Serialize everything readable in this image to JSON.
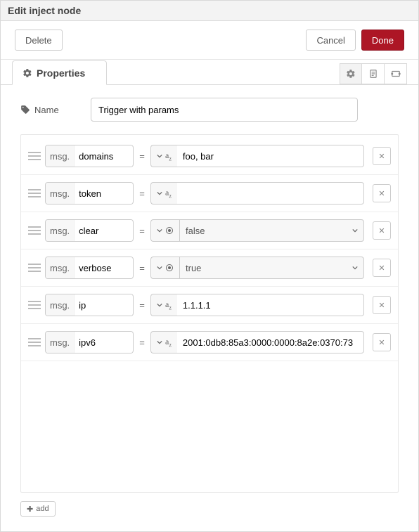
{
  "header": {
    "title": "Edit inject node"
  },
  "actions": {
    "delete": "Delete",
    "cancel": "Cancel",
    "done": "Done"
  },
  "tabs": {
    "properties": "Properties"
  },
  "name": {
    "label": "Name",
    "value": "Trigger with params"
  },
  "msgPrefix": "msg.",
  "eq": "=",
  "addLabel": "add",
  "props": [
    {
      "key": "domains",
      "type": "str",
      "value": "foo, bar"
    },
    {
      "key": "token",
      "type": "str",
      "value": ""
    },
    {
      "key": "clear",
      "type": "bool",
      "value": "false"
    },
    {
      "key": "verbose",
      "type": "bool",
      "value": "true"
    },
    {
      "key": "ip",
      "type": "str",
      "value": "1.1.1.1"
    },
    {
      "key": "ipv6",
      "type": "str",
      "value": "2001:0db8:85a3:0000:0000:8a2e:0370:73"
    }
  ]
}
